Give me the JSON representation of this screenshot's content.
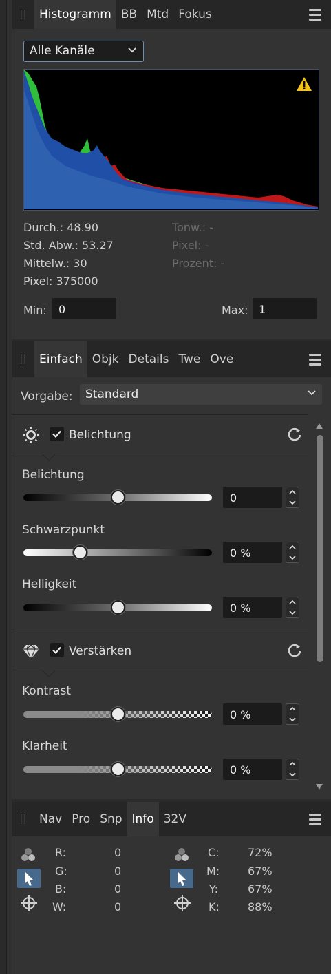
{
  "histogram_panel": {
    "tabs": [
      "Histogramm",
      "BB",
      "Mtd",
      "Fokus"
    ],
    "active_tab": "Histogramm",
    "channel_select": "Alle Kanäle",
    "warning_icon": "warning-triangle-icon",
    "stats_left": [
      {
        "label": "Durch.:",
        "value": "48.90"
      },
      {
        "label": "Std. Abw.:",
        "value": "53.27"
      },
      {
        "label": "Mittelw.:",
        "value": "30"
      },
      {
        "label": "Pixel:",
        "value": "375000"
      }
    ],
    "stats_right": [
      {
        "label": "Tonw.:",
        "value": "-"
      },
      {
        "label": "Pixel:",
        "value": "-"
      },
      {
        "label": "Prozent:",
        "value": "-"
      }
    ],
    "min_label": "Min:",
    "min_value": "0",
    "max_label": "Max:",
    "max_value": "1",
    "colors": {
      "blue": "#1f4fa6",
      "green": "#2fbf3a",
      "red": "#c01818",
      "warning": "#f2c21b"
    }
  },
  "adjust_panel": {
    "tabs": [
      "Einfach",
      "Objk",
      "Details",
      "Twe",
      "Ove"
    ],
    "active_tab": "Einfach",
    "preset_label": "Vorgabe:",
    "preset_value": "Standard",
    "sections": [
      {
        "title": "Belichtung",
        "checked": true,
        "icon": "sun-icon",
        "sliders": [
          {
            "label": "Belichtung",
            "value": "0",
            "position": 0.5
          },
          {
            "label": "Schwarzpunkt",
            "value": "0 %",
            "position": 0.3
          },
          {
            "label": "Helligkeit",
            "value": "0 %",
            "position": 0.5
          }
        ]
      },
      {
        "title": "Verstärken",
        "checked": true,
        "icon": "diamond-icon",
        "sliders": [
          {
            "label": "Kontrast",
            "value": "0 %",
            "position": 0.5
          },
          {
            "label": "Klarheit",
            "value": "0 %",
            "position": 0.5
          }
        ]
      }
    ]
  },
  "info_panel": {
    "tabs": [
      "Nav",
      "Pro",
      "Snp",
      "Info",
      "32V"
    ],
    "active_tab": "Info",
    "rgb": [
      {
        "label": "R:",
        "value": "0"
      },
      {
        "label": "G:",
        "value": "0"
      },
      {
        "label": "B:",
        "value": "0"
      },
      {
        "label": "W:",
        "value": "0"
      }
    ],
    "cmyk": [
      {
        "label": "C:",
        "value": "72%"
      },
      {
        "label": "M:",
        "value": "67%"
      },
      {
        "label": "Y:",
        "value": "67%"
      },
      {
        "label": "K:",
        "value": "88%"
      }
    ]
  }
}
